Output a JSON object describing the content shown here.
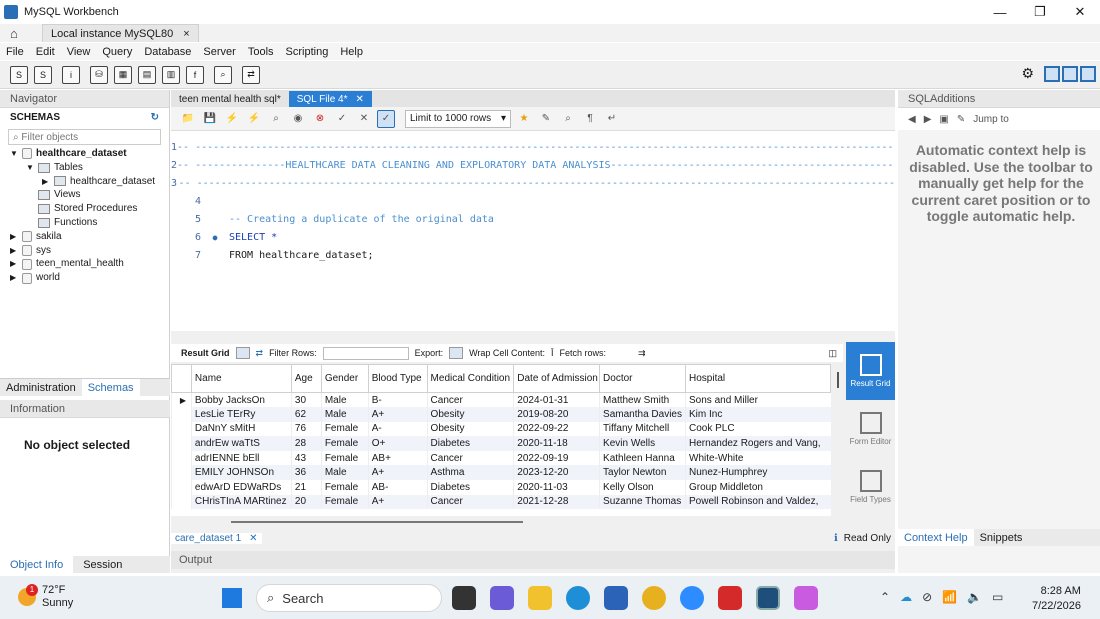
{
  "window": {
    "title": "MySQL Workbench",
    "controls": [
      "—",
      "❐",
      "✕"
    ]
  },
  "connection_tab": {
    "label": "Local instance MySQL80",
    "close": "×"
  },
  "menu": [
    "File",
    "Edit",
    "View",
    "Query",
    "Database",
    "Server",
    "Tools",
    "Scripting",
    "Help"
  ],
  "navigator": {
    "header": "Navigator",
    "schemas_label": "SCHEMAS",
    "filter_placeholder": "Filter objects",
    "tree": [
      {
        "label": "healthcare_dataset",
        "level": 0,
        "expanded": true,
        "bold": true,
        "kind": "db"
      },
      {
        "label": "Tables",
        "level": 1,
        "expanded": true,
        "kind": "folder"
      },
      {
        "label": "healthcare_dataset",
        "level": 2,
        "expanded": false,
        "kind": "table"
      },
      {
        "label": "Views",
        "level": 1,
        "kind": "folder"
      },
      {
        "label": "Stored Procedures",
        "level": 1,
        "kind": "folder"
      },
      {
        "label": "Functions",
        "level": 1,
        "kind": "folder"
      },
      {
        "label": "sakila",
        "level": 0,
        "expanded": false,
        "kind": "db"
      },
      {
        "label": "sys",
        "level": 0,
        "expanded": false,
        "kind": "db"
      },
      {
        "label": "teen_mental_health",
        "level": 0,
        "expanded": false,
        "kind": "db"
      },
      {
        "label": "world",
        "level": 0,
        "expanded": false,
        "kind": "db"
      }
    ],
    "tabs": [
      "Administration",
      "Schemas"
    ],
    "info_header": "Information",
    "no_object": "No object selected",
    "bottom_tabs": [
      "Object Info",
      "Session"
    ]
  },
  "editor": {
    "tabs": [
      "teen mental health sql*",
      "SQL File 4*"
    ],
    "limit": "Limit to 1000 rows",
    "lines": [
      {
        "n": "1",
        "text": "-- ---------------------------------------------------------------------------------------------------------------------",
        "cls": "comment"
      },
      {
        "n": "2",
        "text": "-- ---------------HEALTHCARE DATA CLEANING AND EXPLORATORY DATA ANALYSIS--------------------------------------------------",
        "cls": "comment"
      },
      {
        "n": "3",
        "text": "-- --------------------------------------------------------------------------------------------------------------------",
        "cls": "comment"
      },
      {
        "n": "4",
        "text": "",
        "cls": ""
      },
      {
        "n": "5",
        "text": "-- Creating a duplicate of the original data",
        "cls": "comment"
      },
      {
        "n": "6",
        "text": "SELECT *",
        "cls": "kw",
        "dot": "●"
      },
      {
        "n": "7",
        "text": "FROM healthcare_dataset;",
        "cls": ""
      }
    ]
  },
  "result": {
    "toolbar": {
      "result_grid": "Result Grid",
      "filter_rows": "Filter Rows:",
      "export": "Export:",
      "wrap": "Wrap Cell Content:",
      "fetch": "Fetch rows:"
    },
    "columns": [
      "Name",
      "Age",
      "Gender",
      "Blood Type",
      "Medical Condition",
      "Date of Admission",
      "Doctor",
      "Hospital"
    ],
    "rows": [
      [
        "Bobby JacksOn",
        "30",
        "Male",
        "B-",
        "Cancer",
        "2024-01-31",
        "Matthew Smith",
        "Sons and Miller"
      ],
      [
        "LesLie TErRy",
        "62",
        "Male",
        "A+",
        "Obesity",
        "2019-08-20",
        "Samantha Davies",
        "Kim Inc"
      ],
      [
        "DaNnY sMitH",
        "76",
        "Female",
        "A-",
        "Obesity",
        "2022-09-22",
        "Tiffany Mitchell",
        "Cook PLC"
      ],
      [
        "andrEw waTtS",
        "28",
        "Female",
        "O+",
        "Diabetes",
        "2020-11-18",
        "Kevin Wells",
        "Hernandez Rogers and Vang,"
      ],
      [
        "adrIENNE bEll",
        "43",
        "Female",
        "AB+",
        "Cancer",
        "2022-09-19",
        "Kathleen Hanna",
        "White-White"
      ],
      [
        "EMILY JOHNSOn",
        "36",
        "Male",
        "A+",
        "Asthma",
        "2023-12-20",
        "Taylor Newton",
        "Nunez-Humphrey"
      ],
      [
        "edwArD EDWaRDs",
        "21",
        "Female",
        "AB-",
        "Diabetes",
        "2020-11-03",
        "Kelly Olson",
        "Group Middleton"
      ],
      [
        "CHrisTInA MARtinez",
        "20",
        "Female",
        "A+",
        "Cancer",
        "2021-12-28",
        "Suzanne Thomas",
        "Powell Robinson and Valdez,"
      ]
    ],
    "side": [
      "Result Grid",
      "Form Editor",
      "Field Types"
    ],
    "result_tab": "care_dataset 1",
    "read_only": "Read Only",
    "output": "Output"
  },
  "sql_additions": {
    "header": "SQLAdditions",
    "jump": "Jump to",
    "help": [
      "Automatic context help is",
      "disabled. Use the toolbar to",
      "manually get help for the",
      "current caret position or to",
      "toggle automatic help."
    ],
    "tabs": [
      "Context Help",
      "Snippets"
    ]
  },
  "taskbar": {
    "weather_temp": "72°F",
    "weather_desc": "Sunny",
    "badge": "1",
    "search": "Search",
    "time": "8:28 AM",
    "date": "7/22/2026"
  }
}
